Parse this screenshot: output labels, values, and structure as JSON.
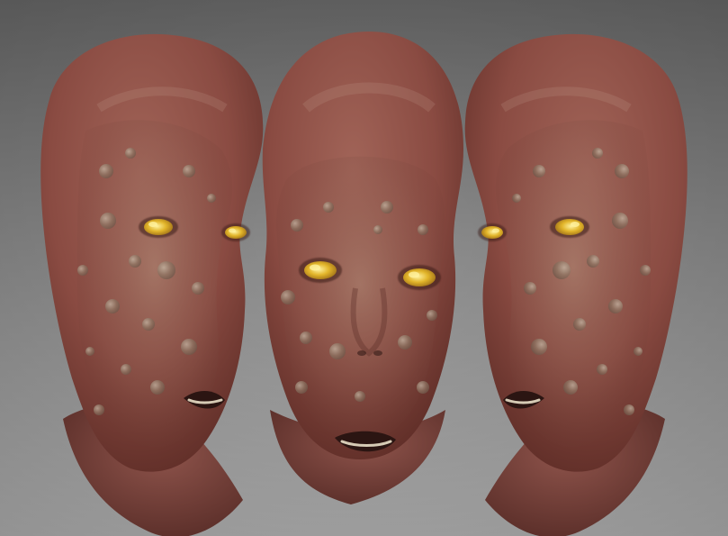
{
  "scene": {
    "views": [
      {
        "name": "three-quarter-left"
      },
      {
        "name": "front"
      },
      {
        "name": "three-quarter-right"
      }
    ]
  },
  "palette": {
    "bg_top": "#6a6a6a",
    "bg_bottom": "#b6b6b6",
    "skin_light": "#a16458",
    "skin_mid": "#8a4b42",
    "skin_dark": "#5a2a24",
    "neck": "#8f5148",
    "lesion_light": "#c6b8a6",
    "lesion_dark": "#6a5346",
    "eye_iris": "#e2b52a",
    "eye_highlight": "#fff2a0",
    "mouth": "#2b1512",
    "teeth": "#d6cbb5"
  }
}
